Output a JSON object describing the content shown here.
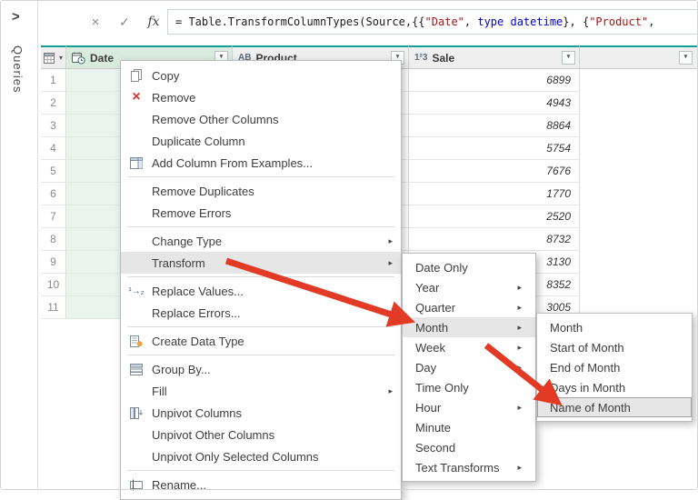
{
  "colors": {
    "teal": "#12A193",
    "header_bg": "#EFEFEF",
    "header_selected_bg": "#D9EBDF",
    "cell_selected_bg": "#EAF4EE",
    "menu_highlight": "#E6E6E6",
    "arrow_red": "#E23A25",
    "string_red": "#A31515",
    "keyword_blue": "#0000D4"
  },
  "sidebar": {
    "expand_glyph": ">",
    "pane_label": "Queries"
  },
  "formula_bar": {
    "cancel_glyph": "×",
    "check_glyph": "✓",
    "fx_label": "fx",
    "parts": [
      {
        "t": "= Table.TransformColumnTypes(Source,{{",
        "c": "plain"
      },
      {
        "t": "\"Date\"",
        "c": "string"
      },
      {
        "t": ", ",
        "c": "plain"
      },
      {
        "t": "type datetime",
        "c": "keyword"
      },
      {
        "t": "}, {",
        "c": "plain"
      },
      {
        "t": "\"Product\"",
        "c": "string"
      },
      {
        "t": ",",
        "c": "plain"
      }
    ]
  },
  "table": {
    "corner_dropdown_glyph": "▾",
    "dropdown_glyph": "▼",
    "columns": [
      {
        "label": "Date",
        "type": "datetime",
        "selected": true
      },
      {
        "label": "Product",
        "type": "text",
        "type_glyph": "AB"
      },
      {
        "label": "Sale",
        "type": "number",
        "type_glyph": "1²3"
      }
    ],
    "rows": [
      {
        "num": "1",
        "sale": "6899"
      },
      {
        "num": "2",
        "sale": "4943"
      },
      {
        "num": "3",
        "sale": "8864"
      },
      {
        "num": "4",
        "sale": "5754"
      },
      {
        "num": "5",
        "sale": "7676"
      },
      {
        "num": "6",
        "sale": "1770"
      },
      {
        "num": "7",
        "sale": "2520"
      },
      {
        "num": "8",
        "sale": "8732"
      },
      {
        "num": "9",
        "sale": "3130"
      },
      {
        "num": "10",
        "sale": "8352"
      },
      {
        "num": "11",
        "sale": "3005"
      }
    ]
  },
  "ui": {
    "submenu_arrow": "▸"
  },
  "context_menu": {
    "items": [
      {
        "label": "Copy",
        "icon": "copy-icon"
      },
      {
        "label": "Remove",
        "icon": "remove-icon"
      },
      {
        "label": "Remove Other Columns"
      },
      {
        "label": "Duplicate Column"
      },
      {
        "label": "Add Column From Examples...",
        "icon": "add-column-from-examples-icon"
      },
      {
        "label": "Remove Duplicates",
        "sep_before": true
      },
      {
        "label": "Remove Errors"
      },
      {
        "label": "Change Type",
        "submenu": true,
        "sep_before": true
      },
      {
        "label": "Transform",
        "submenu": true,
        "highlighted": true
      },
      {
        "label": "Replace Values...",
        "icon": "replace-values-icon",
        "sep_before": true
      },
      {
        "label": "Replace Errors..."
      },
      {
        "label": "Create Data Type",
        "icon": "create-data-type-icon",
        "sep_before": true
      },
      {
        "label": "Group By...",
        "icon": "group-by-icon",
        "sep_before": true
      },
      {
        "label": "Fill",
        "submenu": true
      },
      {
        "label": "Unpivot Columns",
        "icon": "unpivot-columns-icon"
      },
      {
        "label": "Unpivot Other Columns"
      },
      {
        "label": "Unpivot Only Selected Columns"
      },
      {
        "label": "Rename...",
        "icon": "rename-icon",
        "sep_before": true
      }
    ]
  },
  "transform_submenu": {
    "items": [
      {
        "label": "Date Only"
      },
      {
        "label": "Year",
        "submenu": true
      },
      {
        "label": "Quarter",
        "submenu": true
      },
      {
        "label": "Month",
        "submenu": true,
        "highlighted": true
      },
      {
        "label": "Week",
        "submenu": true
      },
      {
        "label": "Day",
        "submenu": true
      },
      {
        "label": "Time Only"
      },
      {
        "label": "Hour",
        "submenu": true
      },
      {
        "label": "Minute"
      },
      {
        "label": "Second"
      },
      {
        "label": "Text Transforms",
        "submenu": true
      }
    ]
  },
  "month_submenu": {
    "items": [
      {
        "label": "Month"
      },
      {
        "label": "Start of Month"
      },
      {
        "label": "End of Month"
      },
      {
        "label": "Days in Month"
      },
      {
        "label": "Name of Month",
        "highlighted": true
      }
    ]
  }
}
